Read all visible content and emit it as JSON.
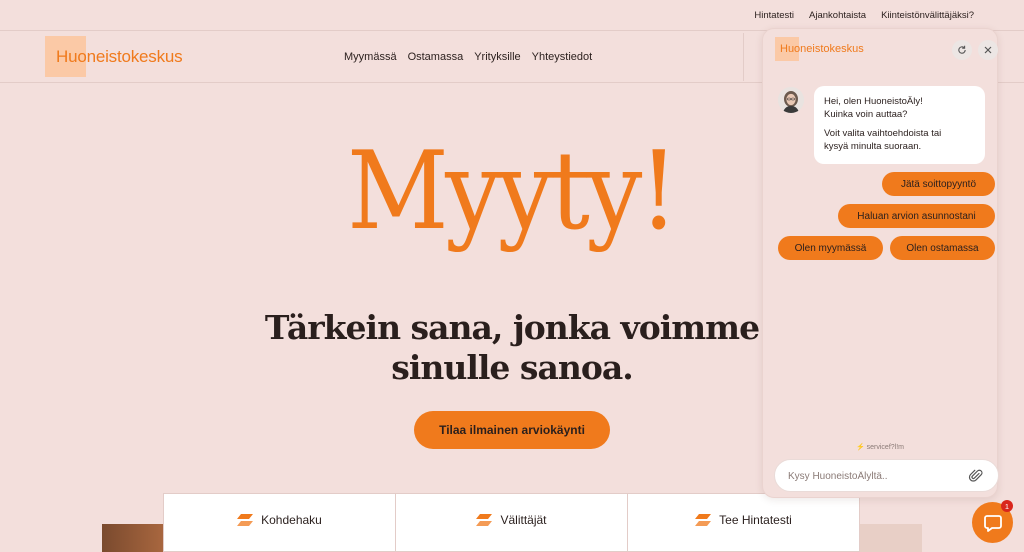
{
  "utility_nav": [
    "Hintatesti",
    "Ajankohtaista",
    "Kiinteistönvälittäjäksi?"
  ],
  "brand": {
    "name": "Huoneistokeskus",
    "accent": "#f07a1c",
    "logo_block": "#fbc9a6"
  },
  "main_nav": [
    "Myymässä",
    "Ostamassa",
    "Yrityksille",
    "Yhteystiedot"
  ],
  "hero": {
    "title": "Myyty!",
    "subtitle_line1": "Tärkein sana, jonka voimme",
    "subtitle_line2": "sinulle sanoa.",
    "cta": "Tilaa ilmainen arviokäynti"
  },
  "bottom_tabs": [
    {
      "label": "Kohdehaku",
      "icon": "brand-mark-icon"
    },
    {
      "label": "Välittäjät",
      "icon": "brand-mark-icon"
    },
    {
      "label": "Tee Hintatesti",
      "icon": "brand-mark-icon"
    }
  ],
  "chat": {
    "brand": "Huoneistokeskus",
    "message_line1": "Hei, olen HuoneistoÄly!",
    "message_line2": "Kuinka voin auttaa?",
    "message_line3": "Voit valita vaihtoehdoista tai",
    "message_line4": "kysyä minulta suoraan.",
    "quick_replies": [
      "Jätä soittopyyntö",
      "Haluan arvion asunnostani",
      "Olen myymässä",
      "Olen ostamassa"
    ],
    "powered_by": "servicef?l!m",
    "input_placeholder": "Kysy HuoneistoÄlyltä.."
  },
  "launcher_badge": "1"
}
